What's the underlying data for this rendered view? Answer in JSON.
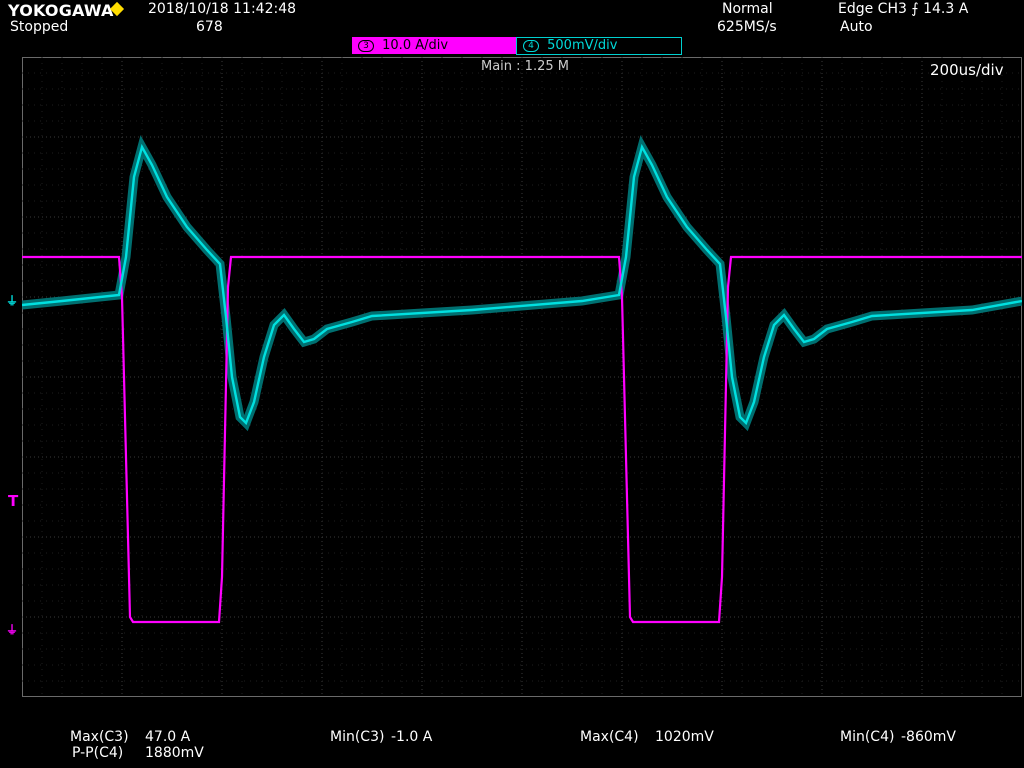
{
  "header": {
    "brand": "YOKOGAWA",
    "status": "Stopped",
    "datetime": "2018/10/18 11:42:48",
    "acquisition_count": "678",
    "acq_mode": "Normal",
    "sample_rate": "625MS/s",
    "trigger": "Edge CH3 ⨍ 14.3 A",
    "trigger_mode": "Auto"
  },
  "channels": [
    {
      "num": "3",
      "label": "10.0 A/div",
      "color": "#ff00ff"
    },
    {
      "num": "4",
      "label": "500mV/div",
      "color": "#00d8d8"
    }
  ],
  "plot": {
    "main_label": "Main : 1.25 M",
    "time_div": "200us/div",
    "trigger_marker": "T",
    "bg_color": "#000000",
    "grid_color": "#3a3a3a"
  },
  "measurements": {
    "max_c3_label": "Max(C3)",
    "max_c3_value": "47.0 A",
    "pp_c4_label": "P-P(C4)",
    "pp_c4_value": "1880mV",
    "min_c3_label": "Min(C3)",
    "min_c3_value": "-1.0 A",
    "max_c4_label": "Max(C4)",
    "max_c4_value": "1020mV",
    "min_c4_label": "Min(C4)",
    "min_c4_value": "-860mV"
  },
  "colors": {
    "ch3": "#ff00ff",
    "ch4": "#00e0e0",
    "ch4_shadow": "#006f70",
    "logo_diamond": "#ffdd00"
  }
}
